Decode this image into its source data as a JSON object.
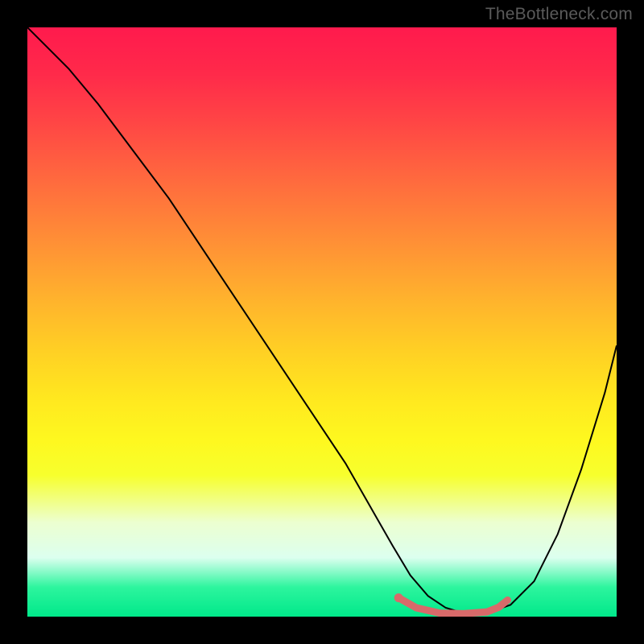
{
  "watermark": "TheBottleneck.com",
  "chart_data": {
    "type": "line",
    "title": "",
    "xlabel": "",
    "ylabel": "",
    "xlim": [
      0,
      100
    ],
    "ylim": [
      0,
      100
    ],
    "grid": false,
    "background_gradient": {
      "direction": "vertical",
      "stops": [
        {
          "pos": 0,
          "color": "#ff1a4d"
        },
        {
          "pos": 50,
          "color": "#ffd024"
        },
        {
          "pos": 100,
          "color": "#00e88a"
        }
      ]
    },
    "series": [
      {
        "name": "bottleneck-curve",
        "type": "line",
        "color": "#000000",
        "x": [
          0,
          3,
          7,
          12,
          18,
          24,
          30,
          36,
          42,
          48,
          54,
          58,
          62,
          65,
          68,
          71,
          74,
          78,
          82,
          86,
          90,
          94,
          98,
          100
        ],
        "values": [
          100,
          97,
          93,
          87,
          79,
          71,
          62,
          53,
          44,
          35,
          26,
          19,
          12,
          7,
          3.5,
          1.5,
          0.6,
          0.6,
          2,
          6,
          14,
          25,
          38,
          46
        ]
      },
      {
        "name": "optimal-range-marker",
        "type": "line",
        "color": "#d86a6a",
        "x": [
          63,
          66,
          70,
          74,
          78,
          80,
          81.5
        ],
        "values": [
          3.2,
          1.5,
          0.6,
          0.5,
          0.8,
          1.6,
          2.8
        ]
      }
    ],
    "annotations": [
      {
        "name": "marker-start-dot",
        "x": 63,
        "y": 3.2,
        "color": "#d86a6a"
      }
    ]
  }
}
